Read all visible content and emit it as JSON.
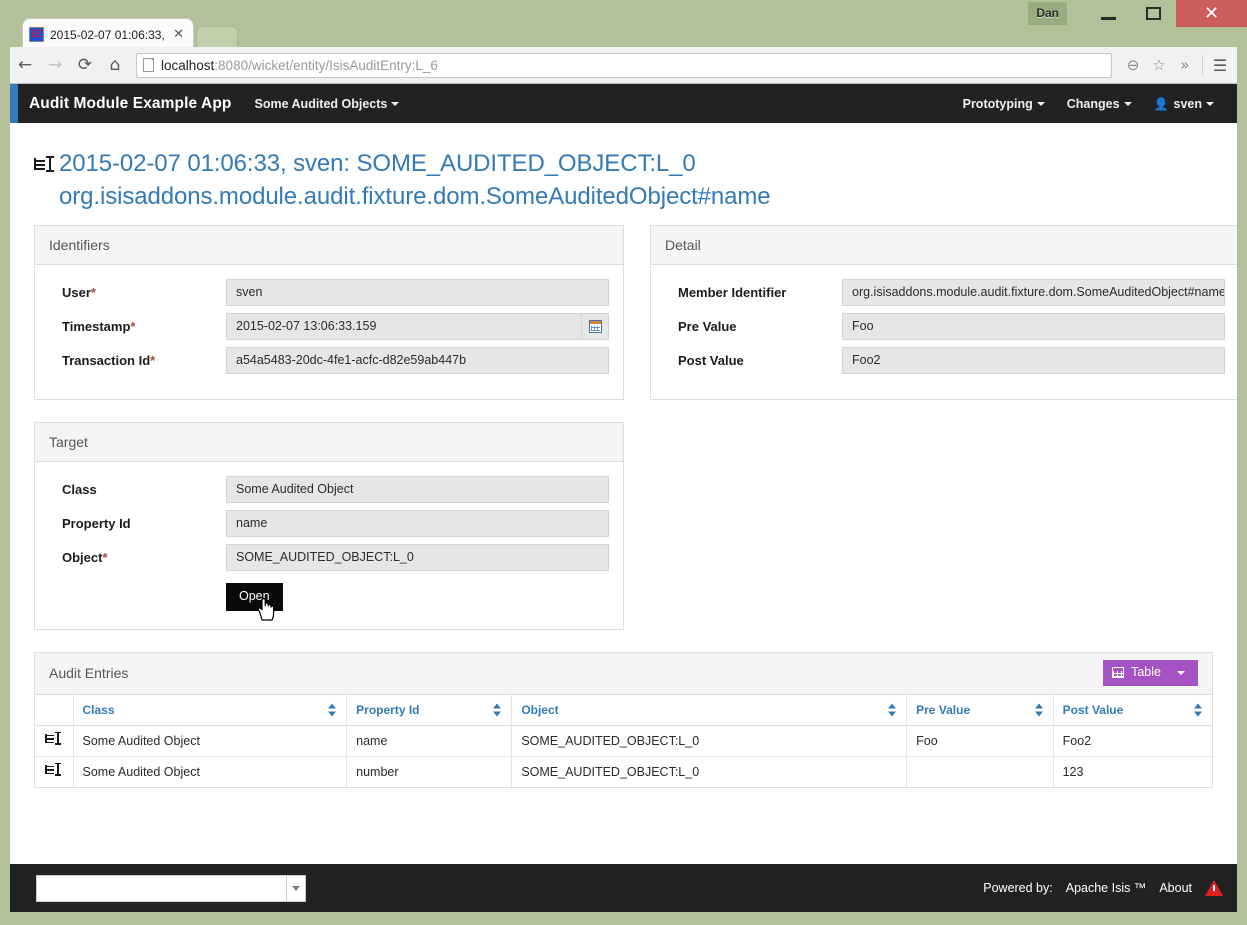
{
  "os_window": {
    "owner_label": "Dan",
    "minimize_icon": "minimize-icon",
    "maximize_icon": "maximize-icon",
    "close_glyph": "✕"
  },
  "browser": {
    "tab": {
      "title": "2015-02-07 01:06:33,",
      "favicon_text": "IΞ",
      "close_glyph": "✕"
    },
    "toolbar": {
      "back_glyph": "←",
      "forward_glyph": "→",
      "reload_glyph": "⟳",
      "home_glyph": "⌂",
      "url_host": "localhost",
      "url_rest": ":8080/wicket/entity/IsisAuditEntry:L_6",
      "zoom_glyph": "⊖",
      "bookmark_glyph": "☆",
      "overflow_glyph": "»",
      "menu_glyph": "☰"
    }
  },
  "navbar": {
    "brand": "Audit Module Example App",
    "accent_color": "#337ab7",
    "left_items": [
      {
        "label": "Some Audited Objects",
        "caret": true
      }
    ],
    "right_items": [
      {
        "label": "Prototyping",
        "caret": true
      },
      {
        "label": "Changes",
        "caret": true
      },
      {
        "label": "sven",
        "caret": true,
        "icon": "user-icon"
      }
    ]
  },
  "page": {
    "icon": "object-icon",
    "title_line1": "2015-02-07 01:06:33, sven: SOME_AUDITED_OBJECT:L_0",
    "title_line2": "org.isisaddons.module.audit.fixture.dom.SomeAuditedObject#name",
    "title_color": "#337ab7"
  },
  "panels": {
    "identifiers": {
      "heading": "Identifiers",
      "fields": [
        {
          "label": "User",
          "required": true,
          "value": "sven",
          "addon": null
        },
        {
          "label": "Timestamp",
          "required": true,
          "value": "2015-02-07 13:06:33.159",
          "addon": "calendar-icon"
        },
        {
          "label": "Transaction Id",
          "required": true,
          "value": "a54a5483-20dc-4fe1-acfc-d82e59ab447b",
          "addon": null
        }
      ]
    },
    "detail": {
      "heading": "Detail",
      "fields": [
        {
          "label": "Member Identifier",
          "required": false,
          "value": "org.isisaddons.module.audit.fixture.dom.SomeAuditedObject#name",
          "addon": null
        },
        {
          "label": "Pre Value",
          "required": false,
          "value": "Foo",
          "addon": null
        },
        {
          "label": "Post Value",
          "required": false,
          "value": "Foo2",
          "addon": null
        }
      ]
    },
    "target": {
      "heading": "Target",
      "fields": [
        {
          "label": "Class",
          "required": false,
          "value": "Some Audited Object",
          "addon": null
        },
        {
          "label": "Property Id",
          "required": false,
          "value": "name",
          "addon": null
        },
        {
          "label": "Object",
          "required": true,
          "value": "SOME_AUDITED_OBJECT:L_0",
          "addon": null
        }
      ],
      "action_label": "Open"
    }
  },
  "collection": {
    "heading": "Audit Entries",
    "view_toggle": {
      "label": "Table",
      "icon": "table-icon",
      "color": "#a552c4"
    },
    "columns": [
      "Class",
      "Property Id",
      "Object",
      "Pre Value",
      "Post Value"
    ],
    "rows": [
      {
        "icon": "object-icon",
        "Class": "Some Audited Object",
        "Property Id": "name",
        "Object": "SOME_AUDITED_OBJECT:L_0",
        "Pre Value": "Foo",
        "Post Value": "Foo2"
      },
      {
        "icon": "object-icon",
        "Class": "Some Audited Object",
        "Property Id": "number",
        "Object": "SOME_AUDITED_OBJECT:L_0",
        "Pre Value": "",
        "Post Value": "123"
      }
    ]
  },
  "app_footer": {
    "select_value": "",
    "powered_by_label": "Powered by:",
    "product": "Apache Isis ™",
    "about_label": "About",
    "warning_icon": "warning-icon"
  }
}
